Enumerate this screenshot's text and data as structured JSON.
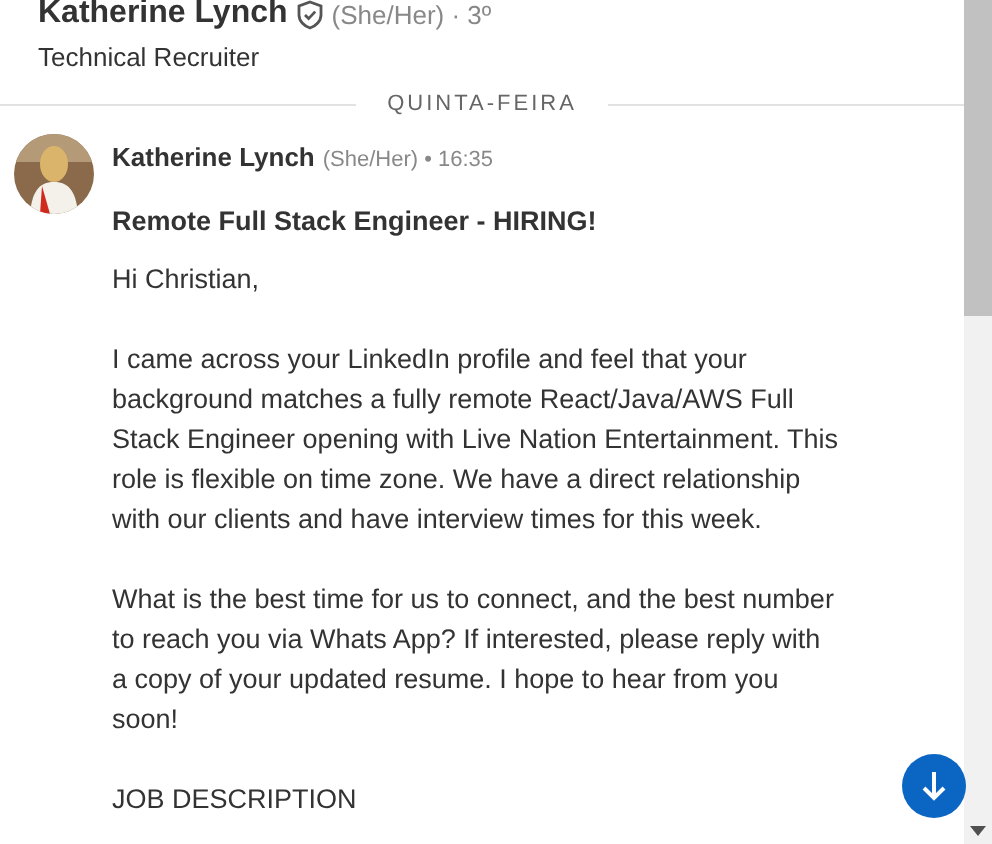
{
  "header": {
    "name": "Katherine Lynch",
    "pronouns": "(She/Her) · 3º",
    "headline": "Technical Recruiter",
    "verified": true
  },
  "day_divider": "QUINTA-FEIRA",
  "message": {
    "sender": "Katherine Lynch",
    "meta": "(She/Her) • 16:35",
    "subject": "Remote Full Stack Engineer - HIRING!",
    "paragraphs": [
      "Hi Christian,",
      "I came across your LinkedIn profile and feel that your background matches a fully remote React/Java/AWS Full Stack Engineer opening with Live Nation Entertainment. This role is flexible on time zone. We have a direct relationship with our clients and have interview times for this week.",
      "What is the best time for us to connect, and the best number to reach you via Whats App? If interested, please reply with a copy of your updated resume. I hope to hear from you soon!",
      "JOB DESCRIPTION"
    ]
  }
}
